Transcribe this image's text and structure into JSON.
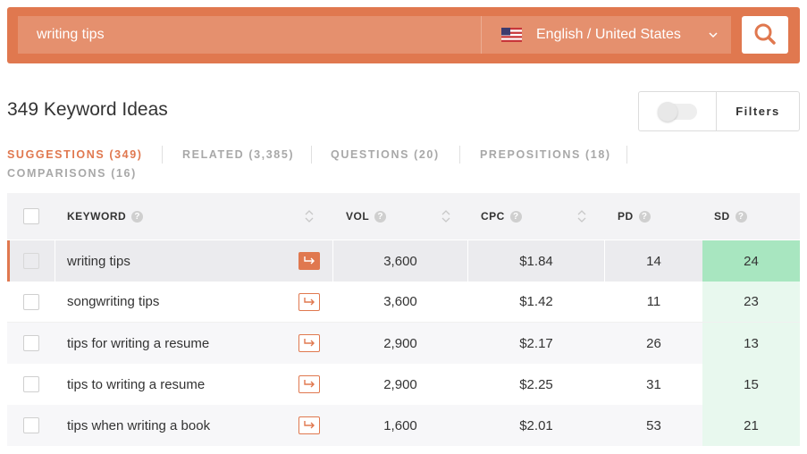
{
  "search": {
    "query": "writing tips",
    "locale": "English / United States"
  },
  "header": {
    "title": "349 Keyword Ideas",
    "filters_label": "Filters"
  },
  "tabs": [
    {
      "label": "SUGGESTIONS (349)"
    },
    {
      "label": "RELATED (3,385)"
    },
    {
      "label": "QUESTIONS (20)"
    },
    {
      "label": "PREPOSITIONS (18)"
    },
    {
      "label": "COMPARISONS (16)"
    }
  ],
  "table": {
    "columns": {
      "keyword": "KEYWORD",
      "vol": "VOL",
      "cpc": "CPC",
      "pd": "PD",
      "sd": "SD"
    },
    "rows": [
      {
        "keyword": "writing tips",
        "vol": "3,600",
        "cpc": "$1.84",
        "pd": "14",
        "sd": "24"
      },
      {
        "keyword": "songwriting tips",
        "vol": "3,600",
        "cpc": "$1.42",
        "pd": "11",
        "sd": "23"
      },
      {
        "keyword": "tips for writing a resume",
        "vol": "2,900",
        "cpc": "$2.17",
        "pd": "26",
        "sd": "13"
      },
      {
        "keyword": "tips to writing a resume",
        "vol": "2,900",
        "cpc": "$2.25",
        "pd": "31",
        "sd": "15"
      },
      {
        "keyword": "tips when writing a book",
        "vol": "1,600",
        "cpc": "$2.01",
        "pd": "53",
        "sd": "21"
      }
    ]
  },
  "colors": {
    "accent": "#e0784f",
    "sd_highlight": "#a8e6c0",
    "sd_light": "#e8f8ee"
  },
  "icons": {
    "search": "search-icon",
    "flag": "us-flag-icon",
    "chevron": "chevron-down-icon",
    "action": "arrow-right-icon",
    "help": "help-icon",
    "sort": "sort-icon"
  }
}
